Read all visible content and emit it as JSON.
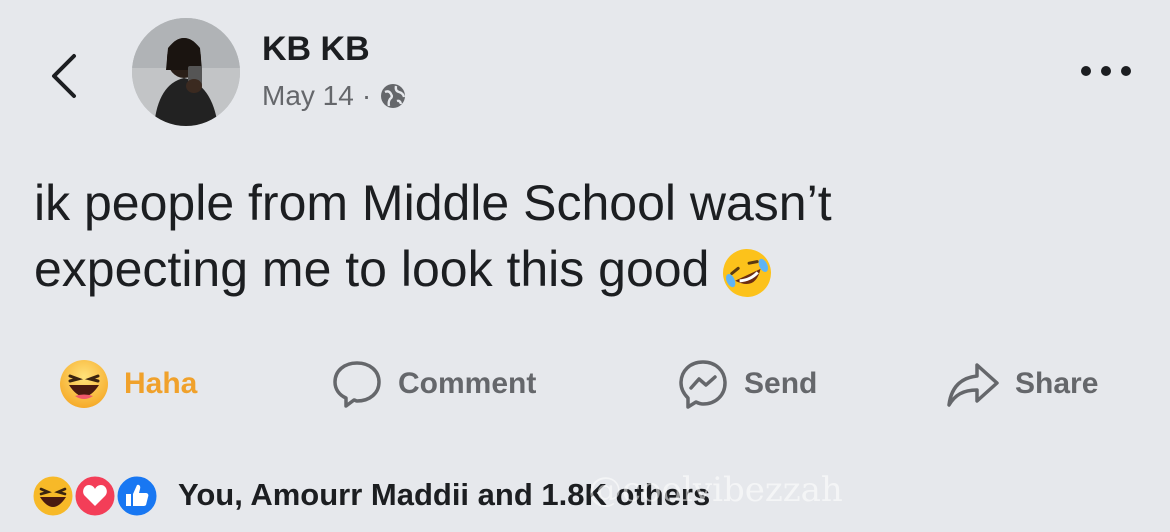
{
  "header": {
    "author_name": "KB KB",
    "date": "May 14",
    "separator": "·",
    "privacy_icon": "globe-icon",
    "back_icon": "chevron-left-icon",
    "more_icon": "more-dots-icon"
  },
  "post": {
    "text_line1": "ik people from Middle School wasn’t",
    "text_line2": "expecting me to look this good",
    "emoji": "rolling-on-floor-laughing-emoji"
  },
  "actions": {
    "haha_label": "Haha",
    "comment_label": "Comment",
    "send_label": "Send",
    "share_label": "Share"
  },
  "reactions": {
    "summary": "You, Amourr Maddii and 1.8K others",
    "icons": [
      "haha-icon",
      "love-icon",
      "like-icon"
    ]
  },
  "watermark": "@coolvibezzah",
  "colors": {
    "background": "#e6e8ec",
    "haha_accent": "#f0a12b",
    "like_blue": "#1877f2",
    "love_red": "#f33e58",
    "secondary_text": "#65676b"
  }
}
